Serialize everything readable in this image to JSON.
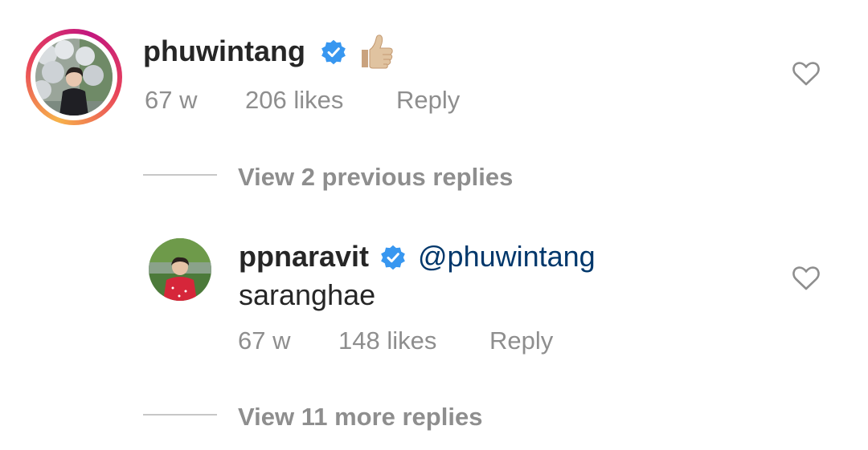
{
  "comments": [
    {
      "username": "phuwintang",
      "emoji": "👍",
      "age": "67 w",
      "likes": "206 likes",
      "reply_label": "Reply",
      "verified": true
    },
    {
      "username": "ppnaravit",
      "mention": "@phuwintang",
      "text": "saranghae",
      "age": "67 w",
      "likes": "148 likes",
      "reply_label": "Reply",
      "verified": true
    }
  ],
  "view_previous_replies": "View 2 previous replies",
  "view_more_replies": "View 11 more replies",
  "icons": {
    "verified": "verified-badge-icon",
    "like": "heart-icon"
  },
  "colors": {
    "verified_blue": "#3897f0",
    "mention_blue": "#00376b",
    "secondary_gray": "#8e8e8e"
  }
}
